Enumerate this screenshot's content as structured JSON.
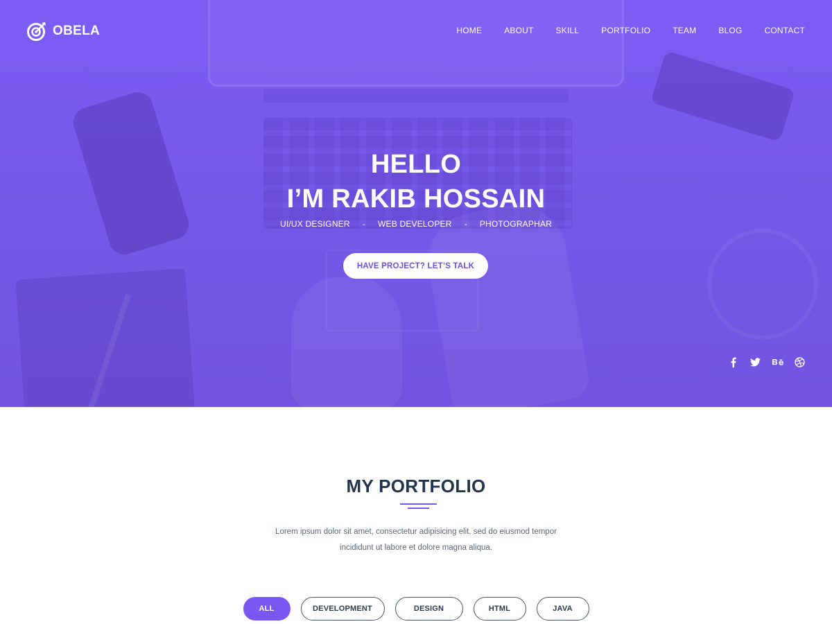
{
  "brand": {
    "name": "OBELA"
  },
  "nav": {
    "items": [
      "HOME",
      "ABOUT",
      "SKILL",
      "PORTFOLIO",
      "TEAM",
      "BLOG",
      "CONTACT"
    ]
  },
  "hero": {
    "line1": "HELLO",
    "line2": "I’M RAKIB HOSSAIN",
    "roles": [
      "UI/UX DESIGNER",
      "WEB DEVELOPER",
      "PHOTOGRAPHAR"
    ],
    "separator": "-",
    "cta_label": "HAVE PROJECT? LET’S TALK",
    "overlay_color": "#7b5af0"
  },
  "social": {
    "icons": [
      "facebook-icon",
      "twitter-icon",
      "behance-icon",
      "dribbble-icon"
    ]
  },
  "portfolio": {
    "title": "MY PORTFOLIO",
    "description": "Lorem ipsum dolor sit amet, consectetur adipisicing elit, sed do eiusmod tempor incididunt ut labore et dolore magna aliqua.",
    "filters": [
      "ALL",
      "DEVELOPMENT",
      "DESIGN",
      "HTML",
      "JAVA"
    ],
    "active_filter": "ALL",
    "accent_color": "#7b57f2"
  }
}
